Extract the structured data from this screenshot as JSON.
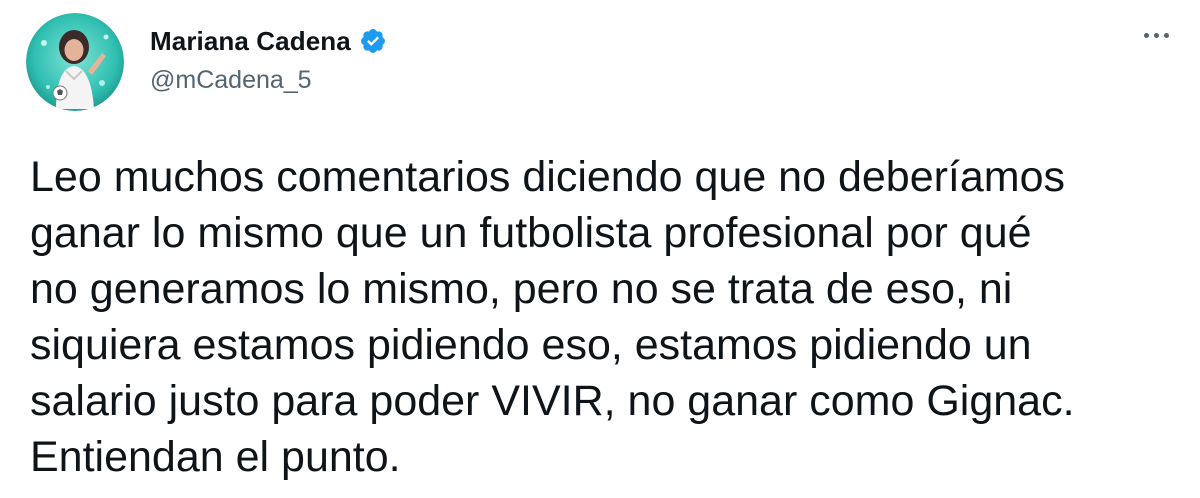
{
  "author": {
    "display_name": "Mariana Cadena",
    "handle": "@mCadena_5",
    "verified": true,
    "verified_color": "#1d9bf0",
    "avatar_icon": "avatar-photo"
  },
  "menu": {
    "icon": "more-options-icon"
  },
  "tweet": {
    "lines": [
      "Leo muchos comentarios diciendo que no deberíamos",
      "ganar lo mismo que un futbolista profesional por qué",
      "no generamos lo mismo, pero no se trata de eso, ni",
      "siquiera estamos pidiendo eso, estamos pidiendo un",
      "salario justo para poder VIVIR, no ganar como Gignac.",
      "Entiendan el punto."
    ]
  },
  "colors": {
    "text": "#0f1419",
    "secondary": "#536471",
    "background": "#ffffff"
  }
}
